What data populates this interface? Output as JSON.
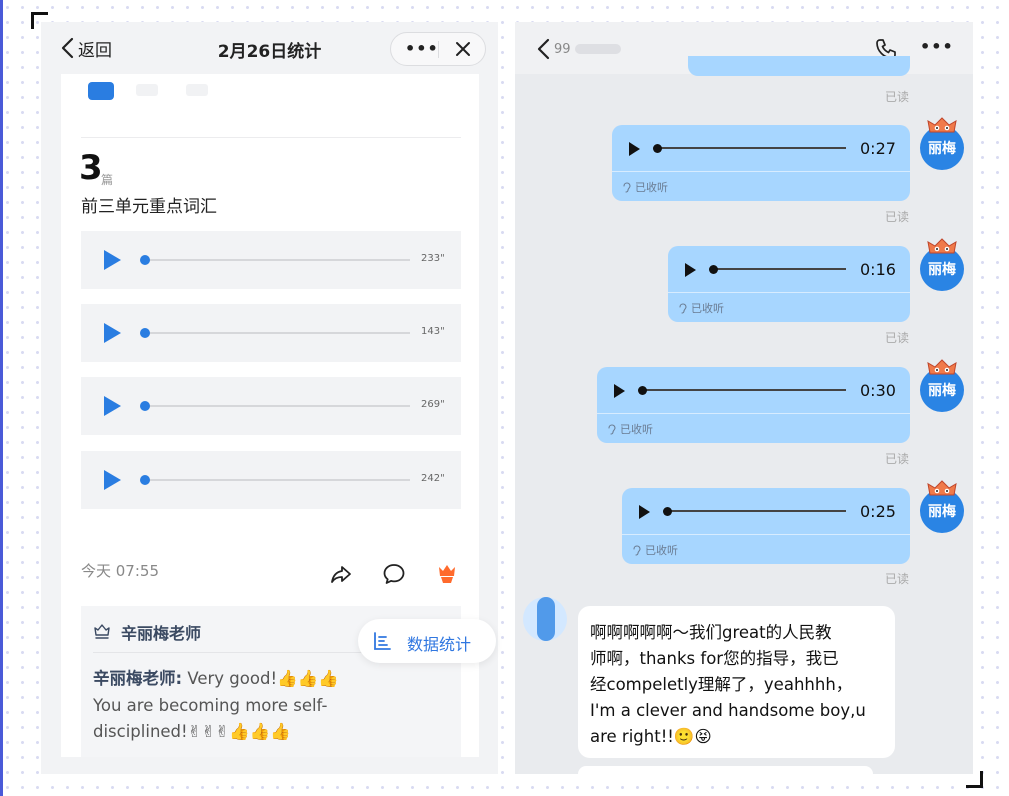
{
  "left": {
    "header": {
      "back_label": "返回",
      "title": "2月26日统计",
      "more_label": "•••"
    },
    "count": {
      "number": "3",
      "unit": "篇"
    },
    "list_title": "前三单元重点词汇",
    "audio_items": [
      {
        "duration": "233\""
      },
      {
        "duration": "143\""
      },
      {
        "duration": "269\""
      },
      {
        "duration": "242\""
      }
    ],
    "time": "今天 07:55",
    "comment": {
      "header": "辛丽梅老师",
      "author": "辛丽梅老师:",
      "text_line1": " Very good!👍👍👍",
      "text_line2": "You are becoming more self-",
      "text_line3": "disciplined!✌✌✌👍👍👍"
    },
    "stats_button": "数据统计"
  },
  "right": {
    "header": {
      "contact_fragment": "99",
      "more_label": "•••"
    },
    "read_label": "已读",
    "heard_label": "已收听",
    "avatar_name": "丽梅",
    "voices": [
      {
        "duration": "0:27"
      },
      {
        "duration": "0:16"
      },
      {
        "duration": "0:30"
      },
      {
        "duration": "0:25"
      }
    ],
    "reply": {
      "line1": "啊啊啊啊啊～我们great的人民教",
      "line2": "师啊，thanks for您的指导，我已",
      "line3": "经compeletly理解了，yeahhhh，",
      "line4": "I'm a clever and handsome boy,u",
      "line5": "are right!!🙂😝"
    }
  },
  "colors": {
    "accent_blue": "#2a7de1",
    "bubble_blue": "#a7d6ff",
    "dot_grid": "#d9dbf2"
  }
}
